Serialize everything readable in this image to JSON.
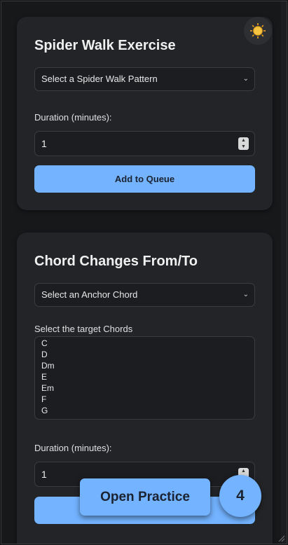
{
  "spider_walk": {
    "title": "Spider Walk Exercise",
    "pattern_select": "Select a Spider Walk Pattern",
    "duration_label": "Duration (minutes):",
    "duration_value": "1",
    "add_button": "Add to Queue"
  },
  "chord_changes": {
    "title": "Chord Changes From/To",
    "anchor_select": "Select an Anchor Chord",
    "target_label": "Select the target Chords",
    "chords": [
      "C",
      "D",
      "Dm",
      "E",
      "Em",
      "F",
      "G"
    ],
    "duration_label": "Duration (minutes):",
    "duration_value": "1"
  },
  "floating": {
    "open_practice": "Open Practice",
    "queue_count": "4"
  },
  "icons": {
    "theme": "sun-icon",
    "select_arrow": "chevron-down-icon",
    "spinner": "stepper-icon"
  },
  "colors": {
    "accent": "#73b3ff",
    "card": "#222427",
    "background": "#17181a"
  }
}
